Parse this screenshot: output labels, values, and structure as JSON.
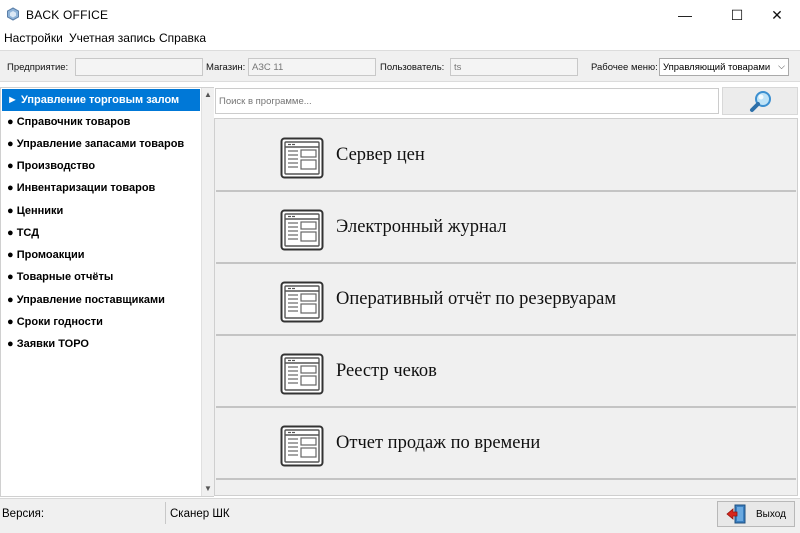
{
  "window": {
    "title": "BACK OFFICE",
    "minimize_glyph": "—",
    "maximize_glyph": "☐",
    "close_glyph": "✕"
  },
  "menu": {
    "items": [
      "Настройки",
      "Учетная запись",
      "Справка"
    ]
  },
  "info": {
    "enterprise_label": "Предприятие:",
    "enterprise_value": "",
    "store_label": "Магазин:",
    "store_value": "АЗС 11",
    "user_label": "Пользователь:",
    "user_value": "ts",
    "workmenu_label": "Рабочее меню:",
    "workmenu_value": "Управляющий товарами"
  },
  "sidebar": {
    "items": [
      {
        "label": "► Управление торговым залом",
        "active": true
      },
      {
        "label": "● Справочник товаров",
        "active": false
      },
      {
        "label": "● Управление запасами товаров",
        "active": false
      },
      {
        "label": "● Производство",
        "active": false
      },
      {
        "label": "● Инвентаризации товаров",
        "active": false
      },
      {
        "label": "● Ценники",
        "active": false
      },
      {
        "label": "● ТСД",
        "active": false
      },
      {
        "label": "● Промоакции",
        "active": false
      },
      {
        "label": "● Товарные отчёты",
        "active": false
      },
      {
        "label": "● Управление поставщиками",
        "active": false
      },
      {
        "label": "● Сроки годности",
        "active": false
      },
      {
        "label": "● Заявки ТОРО",
        "active": false
      }
    ],
    "scroll_up": "▲",
    "scroll_down": "▼"
  },
  "search": {
    "placeholder": "Поиск в программе..."
  },
  "reports": [
    {
      "label": "Сервер цен"
    },
    {
      "label": "Электронный журнал"
    },
    {
      "label": "Оперативный отчёт по резервуарам"
    },
    {
      "label": "Реестр чеков"
    },
    {
      "label": "Отчет продаж по времени"
    }
  ],
  "status": {
    "version_label": "Версия:",
    "scanner_label": "Сканер ШК",
    "exit_label": "Выход"
  },
  "colors": {
    "accent": "#0078d7"
  }
}
